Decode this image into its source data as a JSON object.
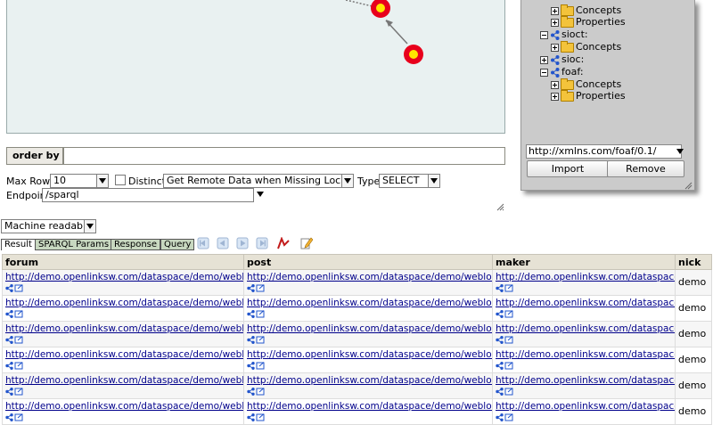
{
  "canvas": {},
  "order_by": {
    "label": "order by",
    "value": ""
  },
  "options": {
    "max_rows_label": "Max Rows",
    "max_rows_value": "10",
    "distinct_label": "Distinct",
    "remote_option": "Get Remote Data when Missing Locally",
    "type_label": "Type",
    "type_value": "SELECT",
    "endpoint_label": "Endpoint",
    "endpoint_value": "/sparql"
  },
  "ns_panel": {
    "tree": [
      {
        "kind": "folder",
        "label": "Concepts"
      },
      {
        "kind": "folder",
        "label": "Properties"
      },
      {
        "kind": "ns",
        "label": "sioct:"
      },
      {
        "kind": "folder",
        "label": "Concepts"
      },
      {
        "kind": "ns",
        "label": "sioc:"
      },
      {
        "kind": "ns",
        "label": "foaf:"
      },
      {
        "kind": "folder",
        "label": "Concepts"
      },
      {
        "kind": "folder",
        "label": "Properties"
      }
    ],
    "ns_input_value": "http://xmlns.com/foaf/0.1/",
    "import_label": "Import",
    "remove_label": "Remove"
  },
  "format_select": "Machine readable",
  "tabs": [
    "Result",
    "SPARQL Params",
    "Response",
    "Query"
  ],
  "results": {
    "columns": [
      "forum",
      "post",
      "maker",
      "nick"
    ],
    "rows": [
      [
        "http://demo.openlinksw.com/dataspace/demo/webl",
        "http://demo.openlinksw.com/dataspace/demo/weblog",
        "http://demo.openlinksw.com/dataspace",
        "demo"
      ],
      [
        "http://demo.openlinksw.com/dataspace/demo/webl",
        "http://demo.openlinksw.com/dataspace/demo/weblog",
        "http://demo.openlinksw.com/dataspace",
        "demo"
      ],
      [
        "http://demo.openlinksw.com/dataspace/demo/webl",
        "http://demo.openlinksw.com/dataspace/demo/weblog",
        "http://demo.openlinksw.com/dataspace",
        "demo"
      ],
      [
        "http://demo.openlinksw.com/dataspace/demo/webl",
        "http://demo.openlinksw.com/dataspace/demo/weblog",
        "http://demo.openlinksw.com/dataspace",
        "demo"
      ],
      [
        "http://demo.openlinksw.com/dataspace/demo/webl",
        "http://demo.openlinksw.com/dataspace/demo/weblog",
        "http://demo.openlinksw.com/dataspace",
        "demo"
      ],
      [
        "http://demo.openlinksw.com/dataspace/demo/webl",
        "http://demo.openlinksw.com/dataspace/demo/weblog",
        "http://demo.openlinksw.com/dataspace",
        "demo"
      ]
    ]
  }
}
